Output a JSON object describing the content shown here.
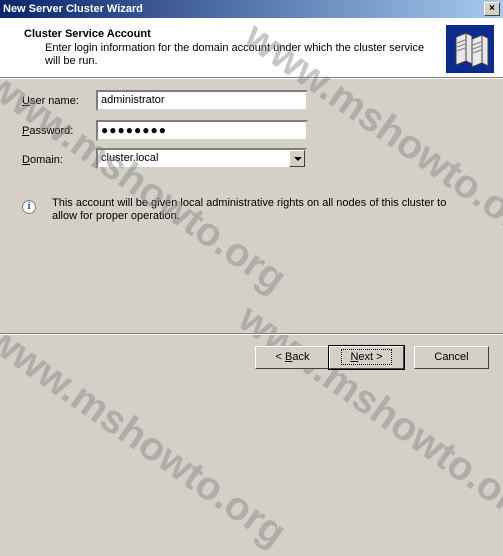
{
  "window": {
    "title": "New Server Cluster Wizard",
    "close_glyph": "×"
  },
  "header": {
    "title": "Cluster Service Account",
    "subtitle": "Enter login information for the domain account under which the cluster service will be run."
  },
  "form": {
    "username": {
      "label_accel": "U",
      "label_rest": "ser name:",
      "value": "administrator"
    },
    "password": {
      "label_accel": "P",
      "label_rest": "assword:",
      "value": "●●●●●●●●"
    },
    "domain": {
      "label_accel": "D",
      "label_rest": "omain:",
      "value": "cluster.local"
    }
  },
  "info": {
    "icon": "information-icon",
    "glyph": "i",
    "text": "This account will be given local administrative rights on all nodes of this cluster to allow for proper operation."
  },
  "buttons": {
    "back_prefix": "< ",
    "back_accel": "B",
    "back_rest": "ack",
    "next_accel": "N",
    "next_rest": "ext >",
    "cancel": "Cancel"
  },
  "watermark": {
    "text": "www.mshowto.org"
  }
}
